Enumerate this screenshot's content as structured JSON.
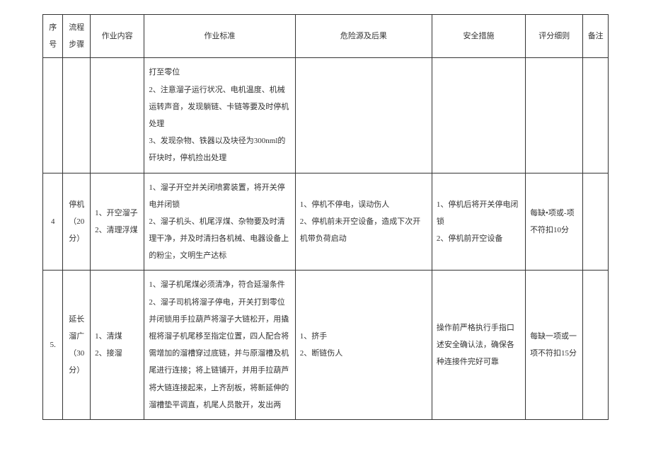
{
  "headers": {
    "seq": "序号",
    "step": "流程步骤",
    "content": "作业内容",
    "standard": "作业标准",
    "hazard": "危险源及后果",
    "measure": "安全措施",
    "criteria": "评分细则",
    "remark": "备注"
  },
  "rows": [
    {
      "seq": "",
      "step": "",
      "content": "",
      "standard": "打至零位\n2、注意溜子运行状况、电机温度、机械运转声音，发现躺链、卡链等要及时停机处理\n3、发现杂物、铁器以及块径为300nml的矸块时，停机捡出处理",
      "hazard": "",
      "measure": "",
      "criteria": "",
      "remark": ""
    },
    {
      "seq": "4",
      "step": "停机（20分）",
      "content": "1、开空溜子\n2、清理浮煤",
      "standard": "1、溜子开空并关闭喷雾装置，将开关停电并闭锁\n2、溜子机头、机尾浮煤、杂物要及时清理干净，并及时清扫各机械、电器设备上的粉尘，文明生产达标",
      "hazard": "1、停机不停电，误动伤人\n2、停机前未开空设备，造成下次开机带负荷启动",
      "measure": "1、停机后将开关停电闭锁\n2、停机前开空设备",
      "criteria": "每缺•项或-项不符扣10分",
      "remark": ""
    },
    {
      "seq": "5.",
      "step": "延长溜广（30分）",
      "content": "1、清煤\n2、接溜",
      "standard": "1、溜子机尾煤必须清净，符合延溜条件 2、溜子司机将溜子停电，开关打到零位并闭锁用手拉葫芦将溜子大链松开，用撬棍将溜子机尾移至指定位置，四人配合将需增加的溜槽穿过底链，并与原溜槽及机尾进行连接；将上链铺开，并用手拉葫芦将大链连接起来，上齐刮板，将新延伸的溜槽垫平调直，机尾人员散开，发出两",
      "hazard": "1、挤手\n2、断链伤人",
      "measure": "操作前严格执行手指口述安全确认法，确保各种连接件完好可靠",
      "criteria": "每缺一项或一项不符扣15分",
      "remark": ""
    }
  ]
}
